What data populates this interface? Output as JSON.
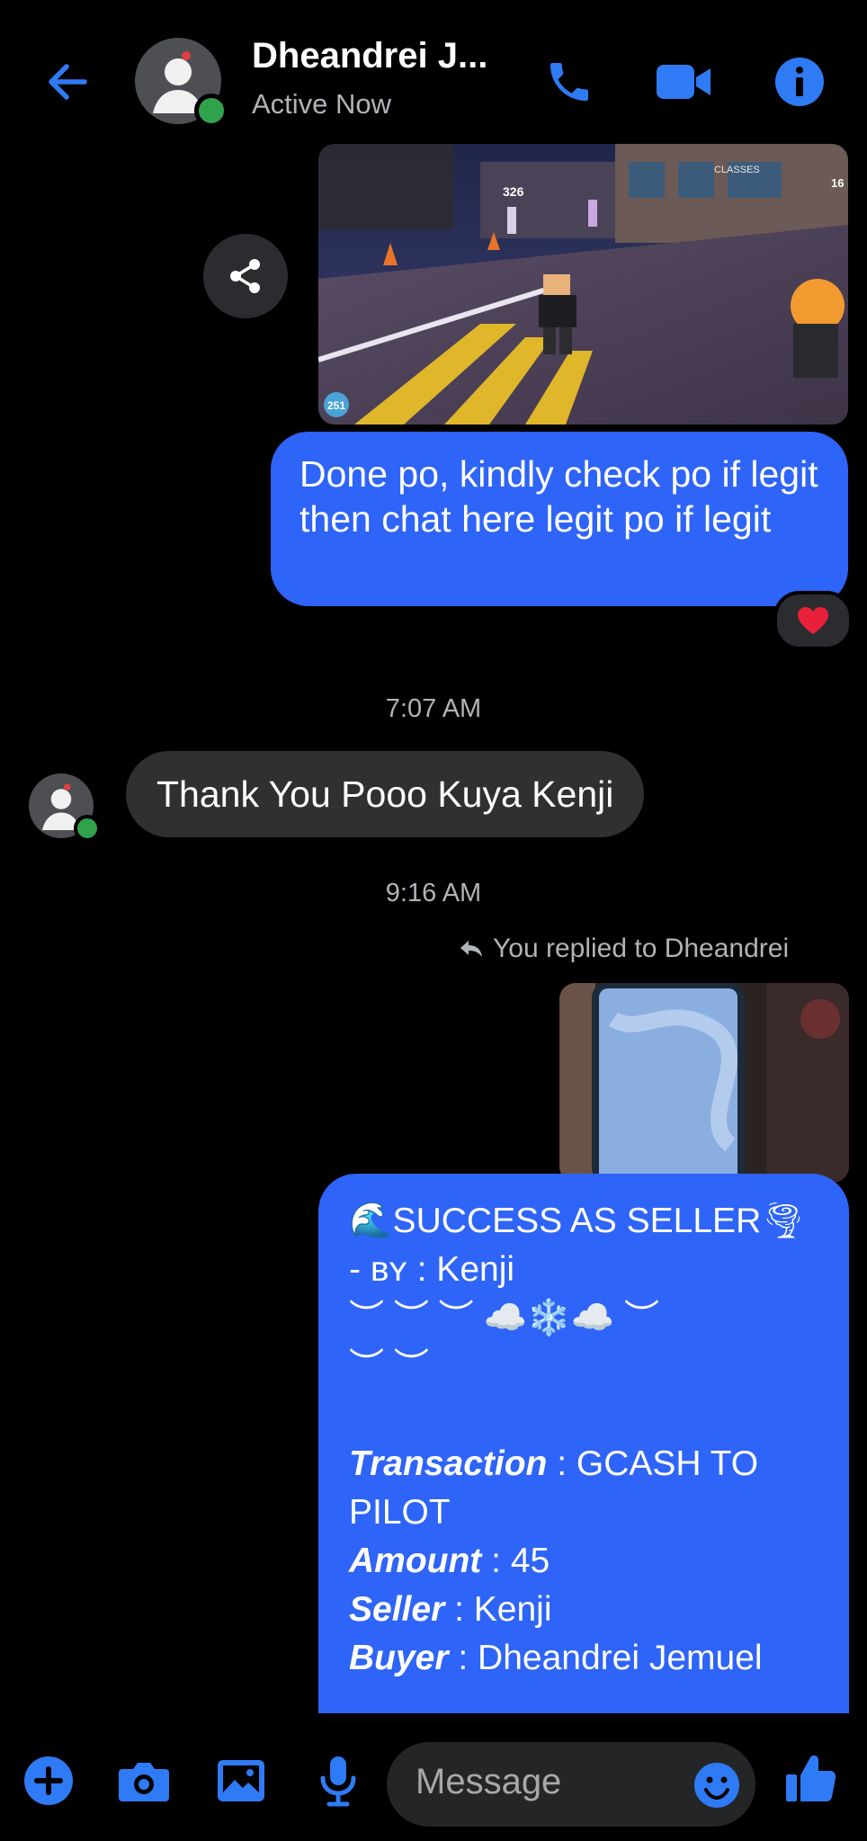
{
  "header": {
    "contact_name": "Dheandrei J...",
    "status": "Active Now"
  },
  "messages": {
    "first_bubble": "Done po, kindly check po if legit then chat here legit po if legit",
    "reaction": "❤️",
    "timestamp_1": "7:07 AM",
    "incoming": "Thank You Pooo Kuya Kenji",
    "timestamp_2": "9:16 AM",
    "replied_to": "You replied to Dheandrei",
    "game_hud": {
      "score": "326",
      "sign": "CLASSES",
      "count": "16",
      "coins": "251"
    },
    "receipt": {
      "title": "🌊SUCCESS AS SELLER🌪",
      "byline": "- ʙʏ : Kenji",
      "decor_1": "︶ ︶ ︶ ☁️❄️☁️ ︶",
      "decor_2": "︶ ︶",
      "transaction_label": "Transaction",
      "transaction_value": " : GCASH TO",
      "transaction_value_2": "PILOT",
      "amount_label": "Amount",
      "amount_value": " : 45",
      "seller_label": "Seller",
      "seller_value": " : Kenji",
      "buyer_label": "Buyer",
      "buyer_value": " : Dheandrei Jemuel"
    }
  },
  "composer": {
    "placeholder": "Message"
  },
  "colors": {
    "accent": "#2e64f7",
    "icon_blue": "#2f7bf5",
    "online": "#31a24c",
    "incoming_bubble": "#303030"
  },
  "icons": [
    "back-arrow-icon",
    "phone-icon",
    "video-icon",
    "info-icon",
    "share-icon",
    "heart-icon",
    "reply-icon",
    "plus-icon",
    "camera-icon",
    "gallery-icon",
    "mic-icon",
    "emoji-icon",
    "thumbs-up-icon"
  ]
}
